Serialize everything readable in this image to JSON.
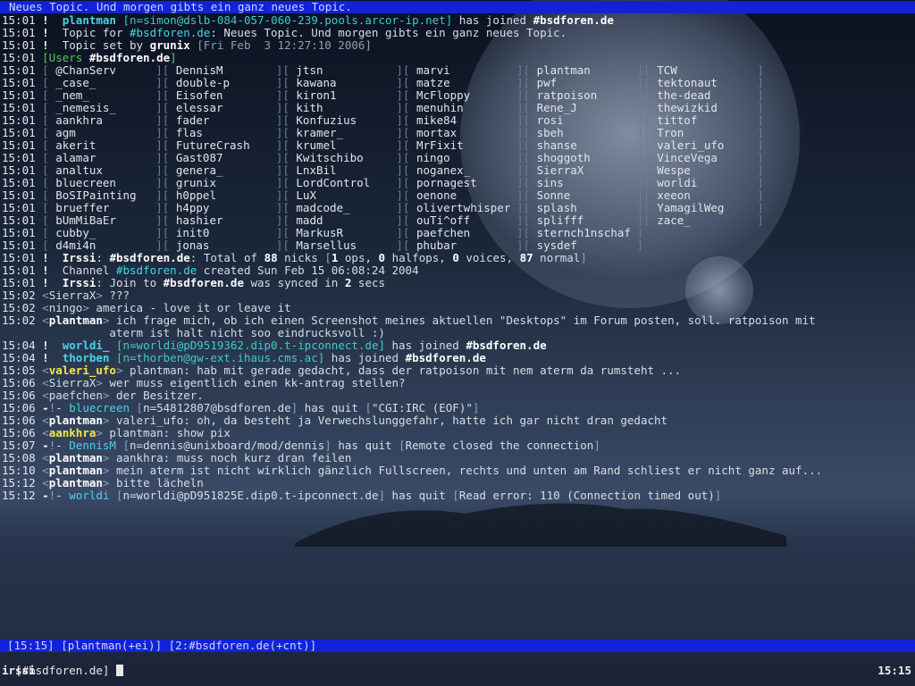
{
  "topic_bar": "Neues Topic. Und morgen gibts ein ganz neues Topic.",
  "log": [
    {
      "ts": "15:01",
      "parts": [
        {
          "c": "bang",
          "t": "!"
        },
        {
          "c": "",
          "t": "  "
        },
        {
          "c": "nick-c",
          "t": "plantman"
        },
        {
          "c": "",
          "t": " "
        },
        {
          "c": "host",
          "t": "[n=simon@dslb-084-057-060-239.pools.arcor-ip.net]"
        },
        {
          "c": "",
          "t": " has joined "
        },
        {
          "c": "chan",
          "t": "#bsdforen.de"
        }
      ]
    },
    {
      "ts": "15:01",
      "parts": [
        {
          "c": "bang",
          "t": "!"
        },
        {
          "c": "",
          "t": "  Topic for "
        },
        {
          "c": "cyan",
          "t": "#bsdforen.de"
        },
        {
          "c": "",
          "t": ": Neues Topic. Und morgen gibts ein ganz neues Topic."
        }
      ]
    },
    {
      "ts": "15:01",
      "parts": [
        {
          "c": "bang",
          "t": "!"
        },
        {
          "c": "",
          "t": "  Topic set by "
        },
        {
          "c": "b",
          "t": "grunix"
        },
        {
          "c": "dim",
          "t": " [Fri Feb  3 12:27:10 2006]"
        }
      ]
    },
    {
      "ts": "15:01",
      "parts": [
        {
          "c": "green",
          "t": "[Users "
        },
        {
          "c": "b",
          "t": "#bsdforen.de"
        },
        {
          "c": "green",
          "t": "]"
        }
      ]
    }
  ],
  "users": [
    [
      "@ChanServ",
      "DennisM",
      "jtsn",
      "marvi",
      "plantman",
      "TCW"
    ],
    [
      "_case_",
      "double-p",
      "kawana",
      "matze",
      "pwf",
      "tektonaut"
    ],
    [
      "_nem_",
      "Eisofen",
      "kiron1",
      "McFloppy",
      "ratpoison",
      "the-dead"
    ],
    [
      "_nemesis_",
      "elessar",
      "kith",
      "menuhin",
      "Rene_J",
      "thewizkid"
    ],
    [
      "aankhra",
      "fader",
      "Konfuzius",
      "mike84",
      "rosi",
      "tittof"
    ],
    [
      "agm",
      "flas",
      "kramer_",
      "mortax",
      "sbeh",
      "Tron"
    ],
    [
      "akerit",
      "FutureCrash",
      "krumel",
      "MrFixit",
      "shanse",
      "valeri_ufo"
    ],
    [
      "alamar",
      "Gast087",
      "Kwitschibo",
      "ningo",
      "shoggoth",
      "VinceVega"
    ],
    [
      "analtux",
      "genera_",
      "LnxBil",
      "noganex_",
      "SierraX",
      "Wespe"
    ],
    [
      "bluecreen",
      "grunix",
      "LordControl",
      "pornagest",
      "sins",
      "worldi"
    ],
    [
      "BoSIPainting",
      "h0ppel",
      "LuX",
      "oenone",
      "Sonne",
      "xeeon"
    ],
    [
      "brueffer",
      "h4ppy",
      "madcode_",
      "olivertwhisper",
      "splash",
      "YamagilWeg"
    ],
    [
      "bUmMiBaEr",
      "hashier",
      "madd",
      "ouTi^off",
      "splifff",
      "zace_"
    ],
    [
      "cubby_",
      "init0",
      "MarkusR",
      "paefchen",
      "sternch1nschaf",
      ""
    ],
    [
      "d4mi4n",
      "jonas",
      "Marsellus",
      "phubar",
      "sysdef",
      ""
    ]
  ],
  "users_ts": "15:01",
  "log2": [
    {
      "ts": "15:01",
      "parts": [
        {
          "c": "bang",
          "t": "!"
        },
        {
          "c": "",
          "t": "  "
        },
        {
          "c": "b",
          "t": "Irssi"
        },
        {
          "c": "",
          "t": ": "
        },
        {
          "c": "b",
          "t": "#bsdforen.de"
        },
        {
          "c": "",
          "t": ": Total of "
        },
        {
          "c": "b",
          "t": "88"
        },
        {
          "c": "",
          "t": " nicks "
        },
        {
          "c": "dim",
          "t": "["
        },
        {
          "c": "b",
          "t": "1"
        },
        {
          "c": "",
          "t": " ops, "
        },
        {
          "c": "b",
          "t": "0"
        },
        {
          "c": "",
          "t": " halfops, "
        },
        {
          "c": "b",
          "t": "0"
        },
        {
          "c": "",
          "t": " voices, "
        },
        {
          "c": "b",
          "t": "87"
        },
        {
          "c": "",
          "t": " normal"
        },
        {
          "c": "dim",
          "t": "]"
        }
      ]
    },
    {
      "ts": "15:01",
      "parts": [
        {
          "c": "bang",
          "t": "!"
        },
        {
          "c": "",
          "t": "  Channel "
        },
        {
          "c": "cyan",
          "t": "#bsdforen.de"
        },
        {
          "c": "",
          "t": " created Sun Feb 15 06:08:24 2004"
        }
      ]
    },
    {
      "ts": "15:01",
      "parts": [
        {
          "c": "bang",
          "t": "!"
        },
        {
          "c": "",
          "t": "  "
        },
        {
          "c": "b",
          "t": "Irssi"
        },
        {
          "c": "",
          "t": ": Join to "
        },
        {
          "c": "b",
          "t": "#bsdforen.de"
        },
        {
          "c": "",
          "t": " was synced in "
        },
        {
          "c": "b",
          "t": "2"
        },
        {
          "c": "",
          "t": " secs"
        }
      ]
    },
    {
      "ts": "15:02",
      "parts": [
        {
          "c": "dim",
          "t": "<"
        },
        {
          "c": "",
          "t": "SierraX"
        },
        {
          "c": "dim",
          "t": ">"
        },
        {
          "c": "",
          "t": " ???"
        }
      ]
    },
    {
      "ts": "15:02",
      "parts": [
        {
          "c": "dim",
          "t": "<"
        },
        {
          "c": "",
          "t": "ningo"
        },
        {
          "c": "dim",
          "t": ">"
        },
        {
          "c": "",
          "t": " america - love it or leave it"
        }
      ]
    },
    {
      "ts": "15:02",
      "parts": [
        {
          "c": "dim",
          "t": "<"
        },
        {
          "c": "b",
          "t": "plantman"
        },
        {
          "c": "dim",
          "t": ">"
        },
        {
          "c": "",
          "t": " ich frage mich, ob ich einen Screenshot meines aktuellen \"Desktops\" im Forum posten, soll. ratpoison mit"
        }
      ]
    },
    {
      "ts": "",
      "parts": [
        {
          "c": "",
          "t": "                aterm ist halt nicht soo eindrucksvoll :)"
        }
      ]
    },
    {
      "ts": "15:04",
      "parts": [
        {
          "c": "bang",
          "t": "!"
        },
        {
          "c": "",
          "t": "  "
        },
        {
          "c": "nick-c",
          "t": "worldi_"
        },
        {
          "c": "",
          "t": " "
        },
        {
          "c": "host",
          "t": "[n=worldi@pD9519362.dip0.t-ipconnect.de]"
        },
        {
          "c": "",
          "t": " has joined "
        },
        {
          "c": "chan",
          "t": "#bsdforen.de"
        }
      ]
    },
    {
      "ts": "15:04",
      "parts": [
        {
          "c": "bang",
          "t": "!"
        },
        {
          "c": "",
          "t": "  "
        },
        {
          "c": "nick-c",
          "t": "thorben"
        },
        {
          "c": "",
          "t": " "
        },
        {
          "c": "host",
          "t": "[n=thorben@gw-ext.ihaus.cms.ac]"
        },
        {
          "c": "",
          "t": " has joined "
        },
        {
          "c": "chan",
          "t": "#bsdforen.de"
        }
      ]
    },
    {
      "ts": "15:05",
      "parts": [
        {
          "c": "dim",
          "t": "<"
        },
        {
          "c": "nick-y",
          "t": "valeri_ufo"
        },
        {
          "c": "dim",
          "t": ">"
        },
        {
          "c": "",
          "t": " plantman: hab mit gerade gedacht, dass der ratpoison mit nem aterm da rumsteht ..."
        }
      ]
    },
    {
      "ts": "15:06",
      "parts": [
        {
          "c": "dim",
          "t": "<"
        },
        {
          "c": "",
          "t": "SierraX"
        },
        {
          "c": "dim",
          "t": ">"
        },
        {
          "c": "",
          "t": " wer muss eigentlich einen kk-antrag stellen?"
        }
      ]
    },
    {
      "ts": "15:06",
      "parts": [
        {
          "c": "dim",
          "t": "<"
        },
        {
          "c": "",
          "t": "paefchen"
        },
        {
          "c": "dim",
          "t": ">"
        },
        {
          "c": "",
          "t": " der Besitzer."
        }
      ]
    },
    {
      "ts": "15:06",
      "parts": [
        {
          "c": "bang",
          "t": "-"
        },
        {
          "c": "dim",
          "t": "!"
        },
        {
          "c": "",
          "t": "- "
        },
        {
          "c": "cyan",
          "t": "bluecreen"
        },
        {
          "c": "",
          "t": " "
        },
        {
          "c": "dim",
          "t": "["
        },
        {
          "c": "",
          "t": "n=54812807@bsdforen.de"
        },
        {
          "c": "dim",
          "t": "]"
        },
        {
          "c": "",
          "t": " has quit "
        },
        {
          "c": "dim",
          "t": "["
        },
        {
          "c": "",
          "t": "\"CGI:IRC (EOF)\""
        },
        {
          "c": "dim",
          "t": "]"
        }
      ]
    },
    {
      "ts": "15:06",
      "parts": [
        {
          "c": "dim",
          "t": "<"
        },
        {
          "c": "b",
          "t": "plantman"
        },
        {
          "c": "dim",
          "t": ">"
        },
        {
          "c": "",
          "t": " valeri_ufo: oh, da besteht ja Verwechslunggefahr, hatte ich gar nicht dran gedacht"
        }
      ]
    },
    {
      "ts": "15:06",
      "parts": [
        {
          "c": "dim",
          "t": "<"
        },
        {
          "c": "nick-y",
          "t": "aankhra"
        },
        {
          "c": "dim",
          "t": ">"
        },
        {
          "c": "",
          "t": " plantman: show pix"
        }
      ]
    },
    {
      "ts": "15:07",
      "parts": [
        {
          "c": "bang",
          "t": "-"
        },
        {
          "c": "dim",
          "t": "!"
        },
        {
          "c": "",
          "t": "- "
        },
        {
          "c": "cyan",
          "t": "DennisM"
        },
        {
          "c": "",
          "t": " "
        },
        {
          "c": "dim",
          "t": "["
        },
        {
          "c": "",
          "t": "n=dennis@unixboard/mod/dennis"
        },
        {
          "c": "dim",
          "t": "]"
        },
        {
          "c": "",
          "t": " has quit "
        },
        {
          "c": "dim",
          "t": "["
        },
        {
          "c": "",
          "t": "Remote closed the connection"
        },
        {
          "c": "dim",
          "t": "]"
        }
      ]
    },
    {
      "ts": "15:08",
      "parts": [
        {
          "c": "dim",
          "t": "<"
        },
        {
          "c": "b",
          "t": "plantman"
        },
        {
          "c": "dim",
          "t": ">"
        },
        {
          "c": "",
          "t": " aankhra: muss noch kurz dran feilen"
        }
      ]
    },
    {
      "ts": "15:10",
      "parts": [
        {
          "c": "dim",
          "t": "<"
        },
        {
          "c": "b",
          "t": "plantman"
        },
        {
          "c": "dim",
          "t": ">"
        },
        {
          "c": "",
          "t": " mein aterm ist nicht wirklich gänzlich Fullscreen, rechts und unten am Rand schliest er nicht ganz auf..."
        }
      ]
    },
    {
      "ts": "15:12",
      "parts": [
        {
          "c": "dim",
          "t": "<"
        },
        {
          "c": "b",
          "t": "plantman"
        },
        {
          "c": "dim",
          "t": ">"
        },
        {
          "c": "",
          "t": " bitte lächeln"
        }
      ]
    },
    {
      "ts": "15:12",
      "parts": [
        {
          "c": "bang",
          "t": "-"
        },
        {
          "c": "dim",
          "t": "!"
        },
        {
          "c": "",
          "t": "- "
        },
        {
          "c": "cyan",
          "t": "worldi"
        },
        {
          "c": "",
          "t": " "
        },
        {
          "c": "dim",
          "t": "["
        },
        {
          "c": "",
          "t": "n=worldi@pD951825E.dip0.t-ipconnect.de"
        },
        {
          "c": "dim",
          "t": "]"
        },
        {
          "c": "",
          "t": " has quit "
        },
        {
          "c": "dim",
          "t": "["
        },
        {
          "c": "",
          "t": "Read error: 110 (Connection timed out)"
        },
        {
          "c": "dim",
          "t": "]"
        }
      ]
    }
  ],
  "status_bar": "[15:15] [plantman(+ei)] [2:#bsdforen.de(+cnt)]",
  "prompt": "[#bsdforen.de] ",
  "bottom_label": "irssi",
  "clock": "15:15"
}
